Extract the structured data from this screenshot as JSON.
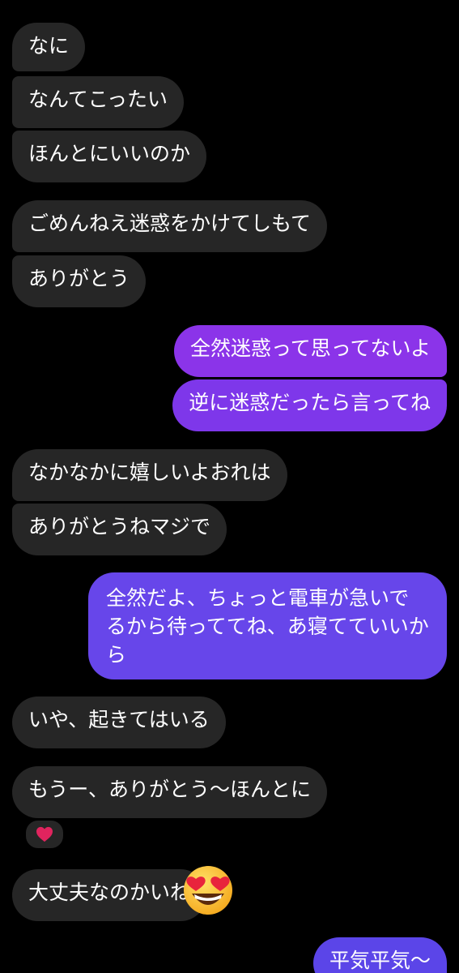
{
  "messages": [
    {
      "id": "m1",
      "side": "received",
      "text": "なに"
    },
    {
      "id": "m2",
      "side": "received",
      "text": "なんてこったい"
    },
    {
      "id": "m3",
      "side": "received",
      "text": "ほんとにいいのか"
    },
    {
      "id": "m4",
      "side": "received",
      "text": "ごめんねえ迷惑をかけてしもて"
    },
    {
      "id": "m5",
      "side": "received",
      "text": "ありがとう"
    },
    {
      "id": "m6",
      "side": "sent",
      "text": "全然迷惑って思ってないよ"
    },
    {
      "id": "m7",
      "side": "sent",
      "text": "逆に迷惑だったら言ってね"
    },
    {
      "id": "m8",
      "side": "received",
      "text": "なかなかに嬉しいよおれは"
    },
    {
      "id": "m9",
      "side": "received",
      "text": "ありがとうねマジで"
    },
    {
      "id": "m10",
      "side": "sent",
      "text": "全然だよ、ちょっと電車が急いでるから待っててね、あ寝てていいから"
    },
    {
      "id": "m11",
      "side": "received",
      "text": "いや、起きてはいる"
    },
    {
      "id": "m12",
      "side": "received",
      "text": "もうー、ありがとう〜ほんとに",
      "reaction": "heart"
    },
    {
      "id": "m13",
      "side": "received",
      "text": "大丈夫なのかいね",
      "overlay_emoji": "heart-eyes-emoji"
    },
    {
      "id": "m14",
      "side": "sent",
      "text": "平気平気〜"
    }
  ],
  "colors": {
    "background": "#000000",
    "received_bubble": "#262626",
    "sent_gradient_top": "#9333ea",
    "sent_gradient_bottom": "#5b45e8",
    "text": "#ffffff",
    "heart": "#e0245e"
  }
}
